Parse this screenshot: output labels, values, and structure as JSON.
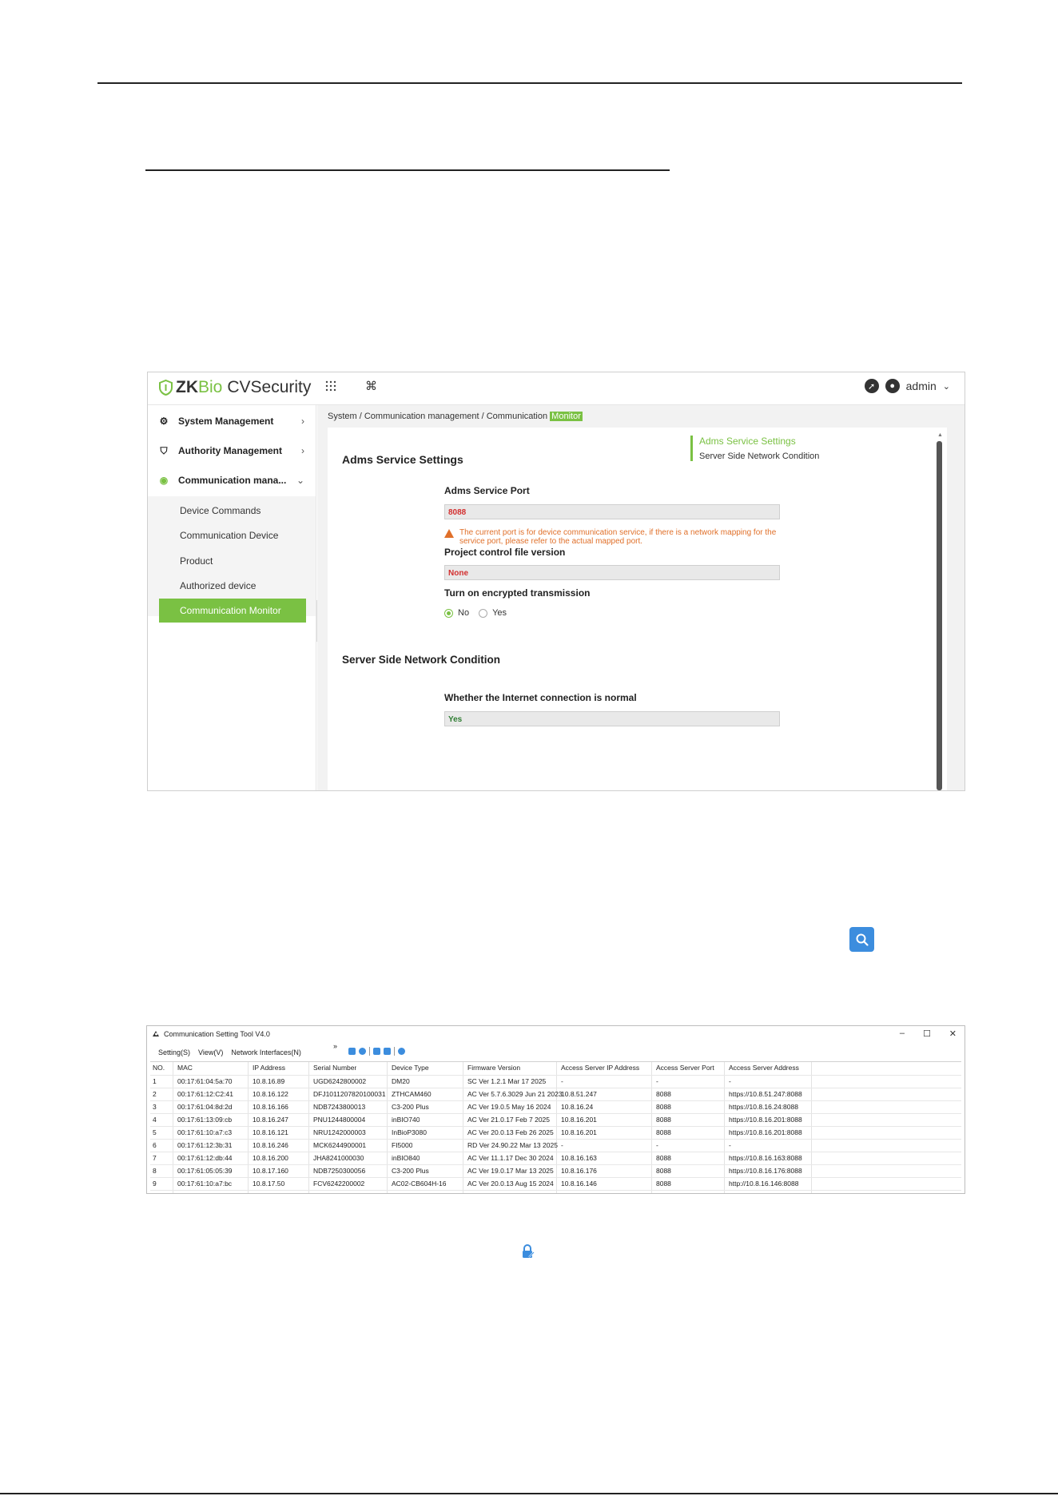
{
  "zk": {
    "brand": {
      "zk": "ZK",
      "bio": "Bio",
      "cv": "CVSecurity"
    },
    "header_icons": {
      "apps": "grid-icon",
      "shortcut": "command-icon",
      "compass": "compass-icon",
      "user": "user-icon"
    },
    "user": {
      "name": "admin",
      "dropdown": "⌄"
    },
    "sidebar": {
      "groups": [
        {
          "label": "System Management",
          "icon": "gear-icon",
          "chevron": "›"
        },
        {
          "label": "Authority Management",
          "icon": "shield-icon",
          "chevron": "›"
        },
        {
          "label": "Communication mana...",
          "icon": "signal-icon",
          "chevron": "⌄"
        }
      ],
      "items": [
        {
          "label": "Device Commands"
        },
        {
          "label": "Communication Device"
        },
        {
          "label": "Product"
        },
        {
          "label": "Authorized device"
        },
        {
          "label": "Communication Monitor"
        }
      ],
      "collapse": "«"
    },
    "breadcrumb": {
      "path": "System / Communication management / Communication ",
      "current": "Monitor"
    },
    "adms": {
      "title": "Adms Service Settings",
      "port_label": "Adms Service Port",
      "port_value": "8088",
      "warning": "The current port is for device communication service, if there is a network mapping for the service port, please refer to the actual mapped port.",
      "version_label": "Project control file version",
      "version_value": "None",
      "encrypt_label": "Turn on encrypted transmission",
      "encrypt_no": "No",
      "encrypt_yes": "Yes",
      "encrypt_selected": "No"
    },
    "network": {
      "title": "Server Side Network Condition",
      "internet_label": "Whether the Internet connection is normal",
      "internet_value": "Yes"
    },
    "anchors": [
      "Adms Service Settings",
      "Server Side Network Condition"
    ],
    "colors": {
      "accent": "#7ac143",
      "error": "#d32f2f",
      "warning": "#e0702a",
      "ok": "#2e7d32"
    }
  },
  "search_button": {
    "icon": "search-icon",
    "color": "#3c8dde"
  },
  "tool": {
    "title": "Communication Setting Tool V4.0",
    "window_controls": [
      "–",
      "☐",
      "✕"
    ],
    "menu": [
      "Setting(S)",
      "View(V)",
      "Network Interfaces(N)"
    ],
    "menu_more": "»",
    "columns": [
      "NO.",
      "MAC",
      "IP Address",
      "Serial Number",
      "Device Type",
      "Firmware Version",
      "Access Server IP Address",
      "Access Server Port",
      "Access Server Address"
    ],
    "rows": [
      [
        "1",
        "00:17:61:04:5a:70",
        "10.8.16.89",
        "UGD6242800002",
        "DM20",
        "SC Ver 1.2.1 Mar 17 2025",
        "-",
        "-",
        "-"
      ],
      [
        "2",
        "00:17:61:12:C2:41",
        "10.8.16.122",
        "DFJ1011207820100031",
        "ZTHCAM460",
        "AC Ver 5.7.6.3029 Jun 21 2023",
        "10.8.51.247",
        "8088",
        "https://10.8.51.247:8088"
      ],
      [
        "3",
        "00:17:61:04:8d:2d",
        "10.8.16.166",
        "NDB7243800013",
        "C3-200 Plus",
        "AC Ver 19.0.5 May 16 2024",
        "10.8.16.24",
        "8088",
        "https://10.8.16.24:8088"
      ],
      [
        "4",
        "00:17:61:13:09:cb",
        "10.8.16.247",
        "PNU1244800004",
        "inBIO740",
        "AC Ver 21.0.17 Feb  7 2025",
        "10.8.16.201",
        "8088",
        "https://10.8.16.201:8088"
      ],
      [
        "5",
        "00:17:61:10:a7:c3",
        "10.8.16.121",
        "NRU1242000003",
        "InBioP3080",
        "AC Ver 20.0.13 Feb 26 2025",
        "10.8.16.201",
        "8088",
        "https://10.8.16.201:8088"
      ],
      [
        "6",
        "00:17:61:12:3b:31",
        "10.8.16.246",
        "MCK6244900001",
        "FI5000",
        "RD Ver 24.90.22 Mar 13 2025",
        "-",
        "-",
        "-"
      ],
      [
        "7",
        "00:17:61:12:db:44",
        "10.8.16.200",
        "JHA8241000030",
        "inBIO840",
        "AC Ver 11.1.17 Dec 30 2024",
        "10.8.16.163",
        "8088",
        "https://10.8.16.163:8088"
      ],
      [
        "8",
        "00:17:61:05:05:39",
        "10.8.17.160",
        "NDB7250300056",
        "C3-200 Plus",
        "AC Ver 19.0.17 Mar 13 2025",
        "10.8.16.176",
        "8088",
        "https://10.8.16.176:8088"
      ],
      [
        "9",
        "00:17:61:10:a7:bc",
        "10.8.17.50",
        "FCV6242200002",
        "AC02-CB604H-16",
        "AC Ver 20.0.13 Aug 15 2024",
        "10.8.16.146",
        "8088",
        "http://10.8.16.146:8088"
      ]
    ]
  },
  "edit_lock_icon": {
    "icon": "lock-edit-icon",
    "color": "#3c8dde"
  }
}
